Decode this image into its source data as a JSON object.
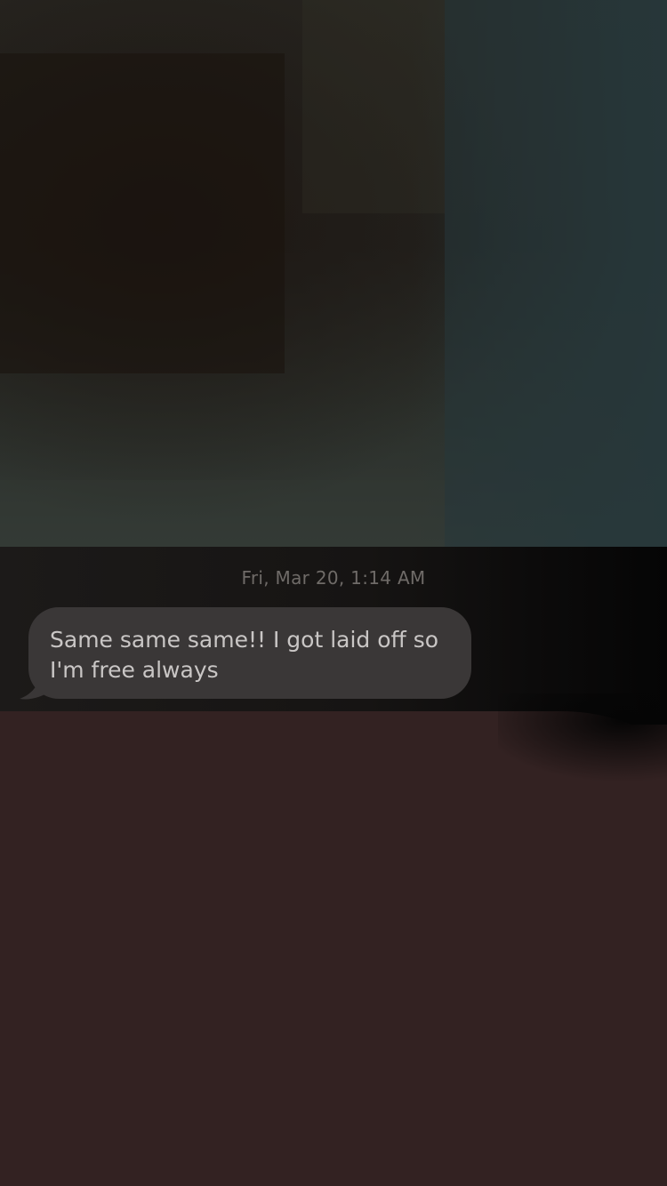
{
  "conversation": {
    "timestamp": "Fri, Mar 20, 1:14 AM",
    "messages": [
      {
        "direction": "incoming",
        "text_line_1": "Same same same!! I got laid off so",
        "text_line_2": "I'm free always"
      }
    ]
  },
  "colors": {
    "bubble_incoming": "#3a3737",
    "bubble_text": "#c9c6c5",
    "timestamp_text": "#6f6b68",
    "background_bottom": "#332222"
  }
}
